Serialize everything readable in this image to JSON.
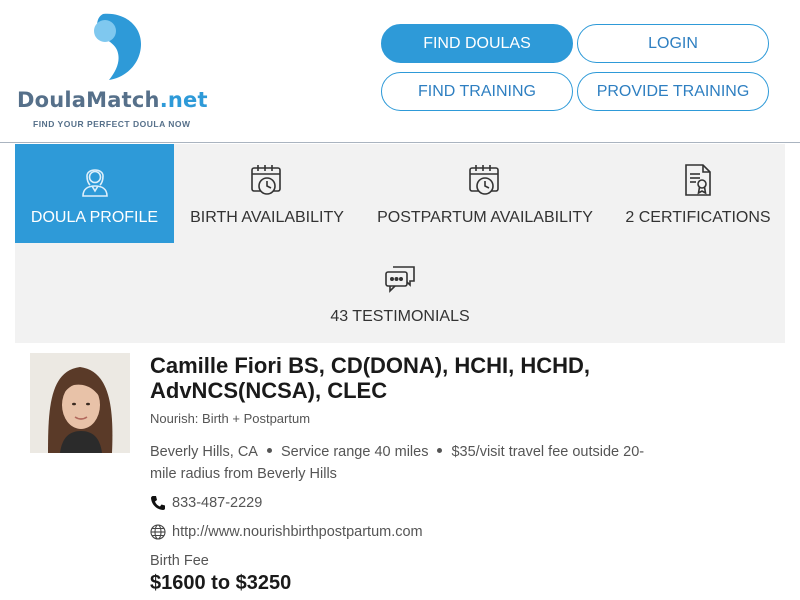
{
  "brand": {
    "name_main": "DoulaMatch",
    "name_suffix": ".net",
    "tagline": "FIND YOUR PERFECT DOULA NOW",
    "primary_color": "#2e9ad8",
    "text_color": "#56708a"
  },
  "nav": {
    "find_doulas": "FIND DOULAS",
    "login": "LOGIN",
    "find_training": "FIND TRAINING",
    "provide_training": "PROVIDE TRAINING"
  },
  "tabs": [
    {
      "label": "DOULA PROFILE",
      "icon": "doula-person-icon",
      "active": true
    },
    {
      "label": "BIRTH AVAILABILITY",
      "icon": "calendar-clock-icon"
    },
    {
      "label": "POSTPARTUM AVAILABILITY",
      "icon": "calendar-clock-icon"
    },
    {
      "label": "2 CERTIFICATIONS",
      "icon": "certificate-icon"
    },
    {
      "label": "43 TESTIMONIALS",
      "icon": "chat-bubbles-icon"
    }
  ],
  "profile": {
    "name": "Camille Fiori BS, CD(DONA), HCHI, HCHD, AdvNCS(NCSA), CLEC",
    "business": "Nourish: Birth + Postpartum",
    "location": "Beverly Hills, CA",
    "service_range": "Service range 40 miles",
    "travel_fee": "$35/visit travel fee outside 20-mile radius from Beverly Hills",
    "phone": "833-487-2229",
    "website": "http://www.nourishbirthpostpartum.com",
    "fee_label": "Birth Fee",
    "fee": "$1600 to $3250"
  }
}
